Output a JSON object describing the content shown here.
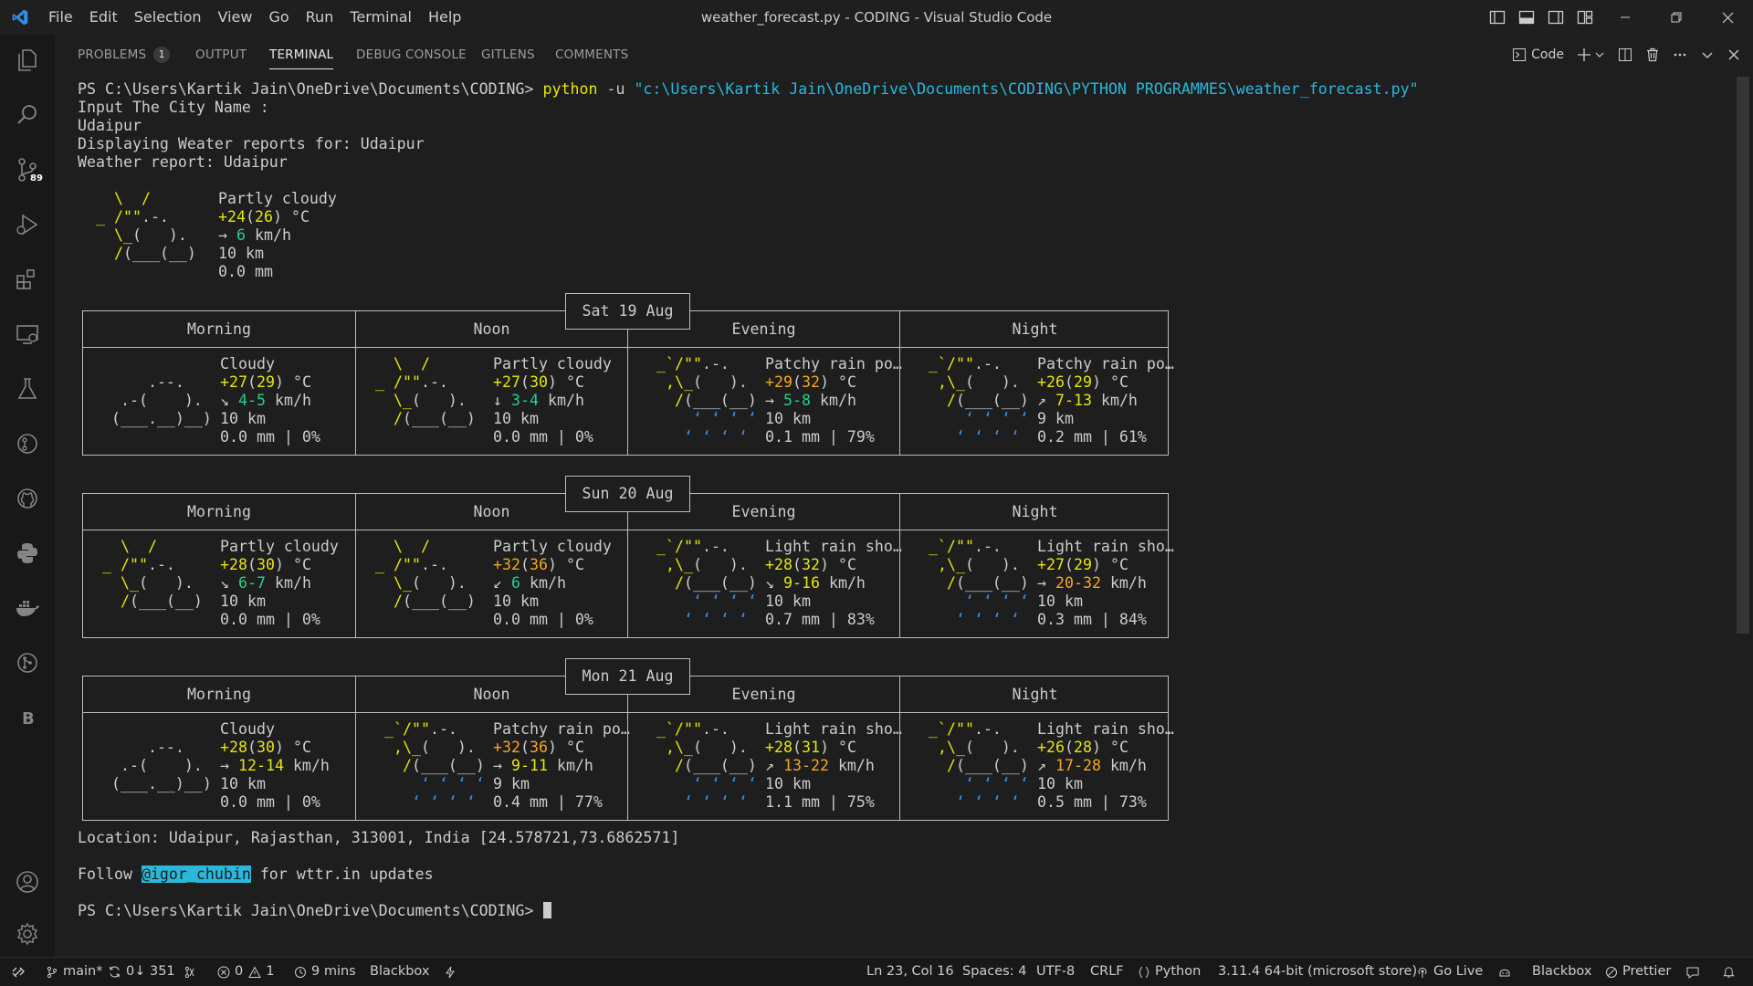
{
  "window": {
    "title": "weather_forecast.py - CODING - Visual Studio Code"
  },
  "menu": [
    "File",
    "Edit",
    "Selection",
    "View",
    "Go",
    "Run",
    "Terminal",
    "Help"
  ],
  "activity_bar": {
    "source_control_badge": "89"
  },
  "panel": {
    "tabs": [
      {
        "label": "PROBLEMS",
        "count": "1"
      },
      {
        "label": "OUTPUT"
      },
      {
        "label": "TERMINAL",
        "active": true
      },
      {
        "label": "DEBUG CONSOLE"
      },
      {
        "label": "GITLENS"
      },
      {
        "label": "COMMENTS"
      }
    ],
    "terminal_profile": "Code"
  },
  "terminal": {
    "prompt": "PS C:\\Users\\Kartik Jain\\OneDrive\\Documents\\CODING> ",
    "command": "python",
    "flag": " -u ",
    "script_path": "\"c:\\Users\\Kartik Jain\\OneDrive\\Documents\\CODING\\PYTHON PROGRAMMES\\weather_forecast.py\"",
    "lines": [
      "Input The City Name :",
      "Udaipur",
      "Displaying Weater reports for: Udaipur",
      "Weather report: Udaipur"
    ],
    "current": {
      "condition": "Partly cloudy",
      "temp": "+24",
      "feels": "26",
      "temp_unit": " °C",
      "wind_dir": "→",
      "wind": "6",
      "wind_unit": " km/h",
      "visibility": "10 km",
      "precip": "0.0 mm"
    },
    "days": [
      {
        "date": "Sat 19 Aug",
        "periods": [
          {
            "name": "Morning",
            "condition": "Cloudy",
            "art": "cloudy",
            "temp": "+27",
            "feels": "29",
            "wind_dir": "↘",
            "wind": "4-5",
            "vis": "10 km",
            "precip": "0.0 mm | 0%"
          },
          {
            "name": "Noon",
            "condition": "Partly cloudy",
            "art": "partly",
            "temp": "+27",
            "feels": "30",
            "wind_dir": "↓",
            "wind": "3-4",
            "vis": "10 km",
            "precip": "0.0 mm | 0%"
          },
          {
            "name": "Evening",
            "condition": "Patchy rain po…",
            "art": "rain",
            "temp": "+29",
            "feels": "32",
            "wind_dir": "→",
            "wind": "5-8",
            "vis": "10 km",
            "precip": "0.1 mm | 79%"
          },
          {
            "name": "Night",
            "condition": "Patchy rain po…",
            "art": "rain",
            "temp": "+26",
            "feels": "29",
            "wind_dir": "↗",
            "wind": "7-13",
            "vis": "9 km",
            "precip": "0.2 mm | 61%"
          }
        ]
      },
      {
        "date": "Sun 20 Aug",
        "periods": [
          {
            "name": "Morning",
            "condition": "Partly cloudy",
            "art": "partly",
            "temp": "+28",
            "feels": "30",
            "wind_dir": "↘",
            "wind": "6-7",
            "vis": "10 km",
            "precip": "0.0 mm | 0%"
          },
          {
            "name": "Noon",
            "condition": "Partly cloudy",
            "art": "partly",
            "temp": "+32",
            "feels": "36",
            "wind_dir": "↙",
            "wind": "6",
            "vis": "10 km",
            "precip": "0.0 mm | 0%"
          },
          {
            "name": "Evening",
            "condition": "Light rain sho…",
            "art": "rain",
            "temp": "+28",
            "feels": "32",
            "wind_dir": "↘",
            "wind": "9-16",
            "vis": "10 km",
            "precip": "0.7 mm | 83%"
          },
          {
            "name": "Night",
            "condition": "Light rain sho…",
            "art": "rain",
            "temp": "+27",
            "feels": "29",
            "wind_dir": "→",
            "wind": "20-32",
            "vis": "10 km",
            "precip": "0.3 mm | 84%"
          }
        ]
      },
      {
        "date": "Mon 21 Aug",
        "periods": [
          {
            "name": "Morning",
            "condition": "Cloudy",
            "art": "cloudy",
            "temp": "+28",
            "feels": "30",
            "wind_dir": "→",
            "wind": "12-14",
            "vis": "10 km",
            "precip": "0.0 mm | 0%"
          },
          {
            "name": "Noon",
            "condition": "Patchy rain po…",
            "art": "rain",
            "temp": "+32",
            "feels": "36",
            "wind_dir": "→",
            "wind": "9-11",
            "vis": "9 km",
            "precip": "0.4 mm | 77%"
          },
          {
            "name": "Evening",
            "condition": "Light rain sho…",
            "art": "rain",
            "temp": "+28",
            "feels": "31",
            "wind_dir": "↗",
            "wind": "13-22",
            "vis": "10 km",
            "precip": "1.1 mm | 75%"
          },
          {
            "name": "Night",
            "condition": "Light rain sho…",
            "art": "rain",
            "temp": "+26",
            "feels": "28",
            "wind_dir": "↗",
            "wind": "17-28",
            "vis": "10 km",
            "precip": "0.5 mm | 73%"
          }
        ]
      }
    ],
    "location": "Location: Udaipur, Rajasthan, 313001, India [24.578721,73.6862571]",
    "follow_prefix": "Follow ",
    "follow_handle": "@igor_chubin",
    "follow_suffix": " for wttr.in updates",
    "final_prompt": "PS C:\\Users\\Kartik Jain\\OneDrive\\Documents\\CODING> "
  },
  "statusbar": {
    "branch": "main*",
    "sync": "0↓ 351",
    "errors": "0",
    "warnings": "1",
    "time": "9 mins",
    "blackbox_left": "Blackbox",
    "position": "Ln 23, Col 16",
    "spaces": "Spaces: 4",
    "encoding": "UTF-8",
    "eol": "CRLF",
    "language": "Python",
    "interpreter": "3.11.4 64-bit (microsoft store)",
    "golive": "Go Live",
    "blackbox_right": "Blackbox",
    "prettier": "Prettier"
  },
  "colors": {
    "accent": "#0078d4",
    "yellow": "#e5e510",
    "green": "#23d18b",
    "orange": "#f5a623",
    "blue": "#3b8eea",
    "cyan": "#29b8db"
  }
}
